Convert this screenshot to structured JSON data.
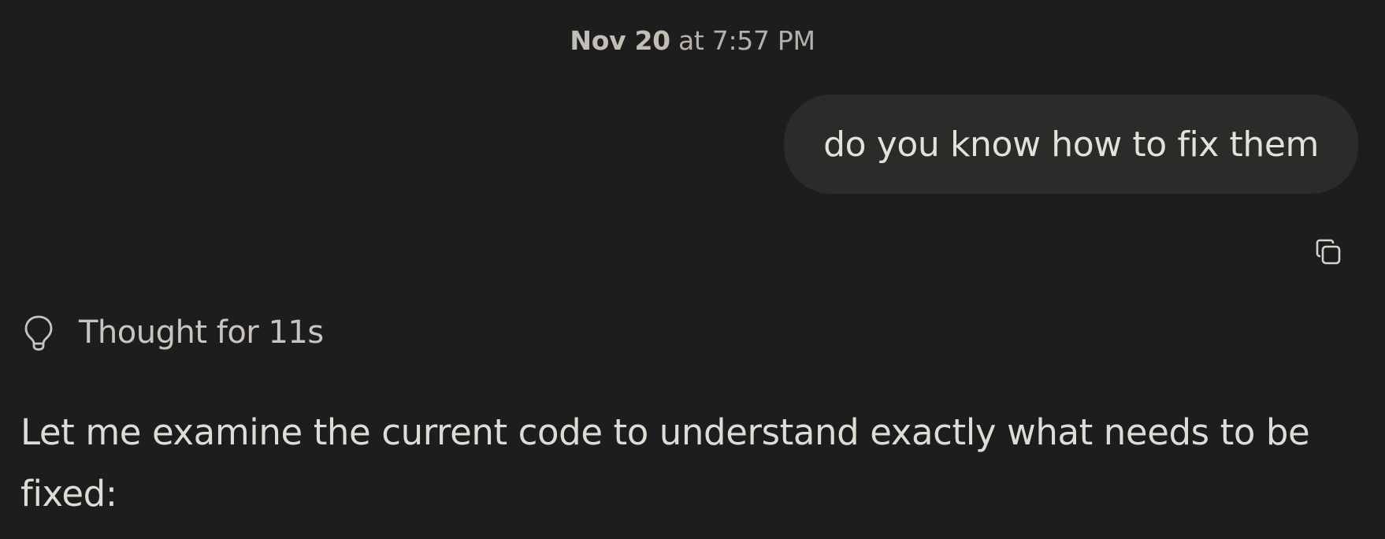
{
  "header": {
    "date": "Nov 20",
    "time": "at 7:57 PM"
  },
  "user_message": {
    "text": "do you know how to fix them"
  },
  "actions": {
    "copy_icon": "copy-icon"
  },
  "thought": {
    "icon": "lightbulb-icon",
    "label": "Thought for 11s"
  },
  "assistant_message": {
    "text": "Let me examine the current code to understand exactly what needs to be fixed:"
  },
  "colors": {
    "background": "#1d1d1d",
    "bubble": "#2b2b29",
    "text": "#dfdcd5",
    "muted": "#b5b1aa"
  }
}
